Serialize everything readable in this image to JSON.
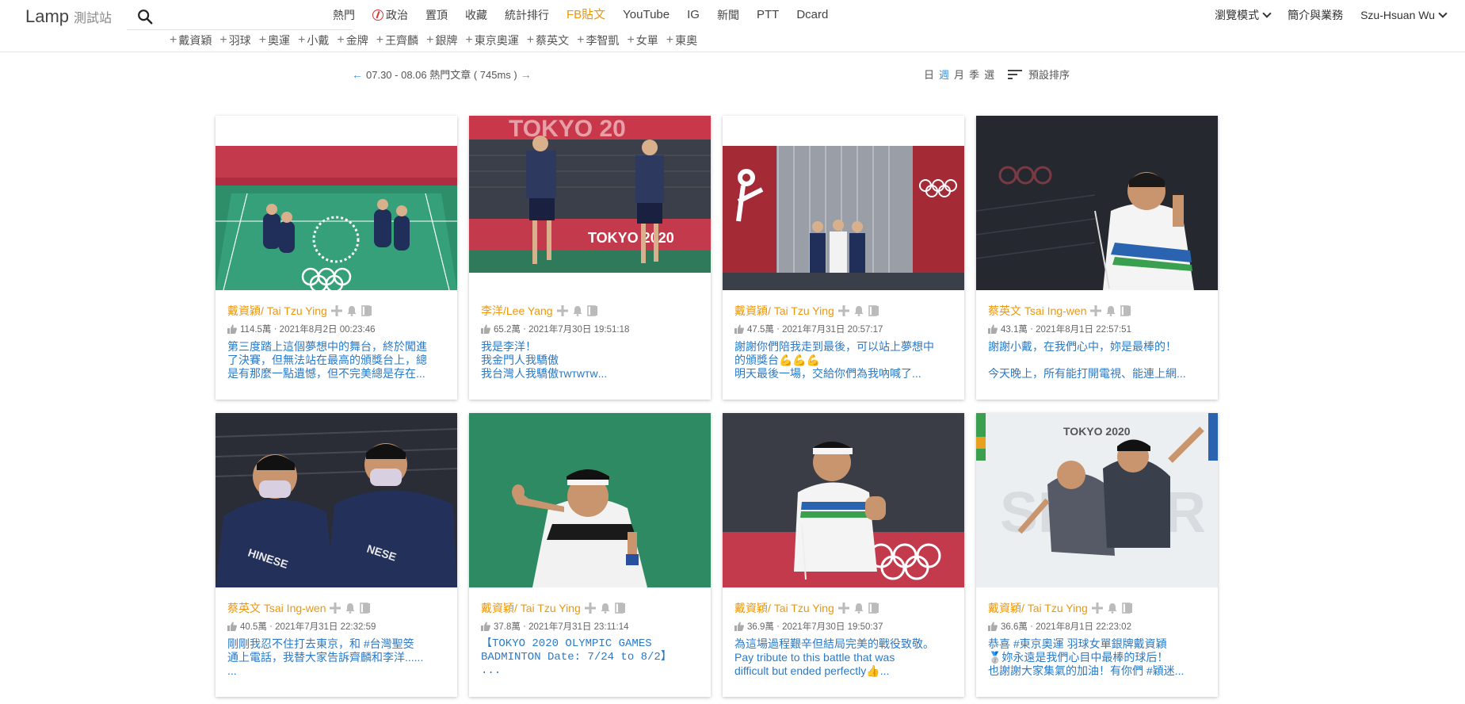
{
  "header": {
    "logo": "Lamp",
    "logo_sub": "測試站",
    "search_placeholder": "",
    "nav": [
      "熱門",
      "政治",
      "置頂",
      "收藏",
      "統計排行",
      "FB貼文",
      "YouTube",
      "IG",
      "新聞",
      "PTT",
      "Dcard"
    ],
    "right": {
      "view_mode": "瀏覽模式",
      "about": "簡介與業務",
      "user": "Szu-Hsuan Wu"
    },
    "tags": [
      "戴資穎",
      "羽球",
      "奧運",
      "小戴",
      "金牌",
      "王齊麟",
      "銀牌",
      "東京奧運",
      "蔡英文",
      "李智凱",
      "女單",
      "東奧"
    ]
  },
  "subbar": {
    "range": "07.30 - 08.06 熱門文章 ( 745ms )",
    "periods": [
      "日",
      "週",
      "月",
      "季",
      "選"
    ],
    "active_period": "週",
    "sort_label": "預設排序"
  },
  "posts": [
    {
      "author": "戴資穎/ Tai Tzu Ying",
      "likes": "114.5萬",
      "date": "2021年8月2日 00:23:46",
      "text": "第三度踏上這個夢想中的舞台，終於闖進\n了決賽，但無法站在最高的頒獎台上，總\n是有那麼一點遺憾，但不完美總是存在..."
    },
    {
      "author": "李洋/Lee Yang",
      "likes": "65.2萬",
      "date": "2021年7月30日 19:51:18",
      "text": "我是李洋！\n我金門人我驕傲\n我台灣人我驕傲ᴛᴡᴛᴡᴛᴡ..."
    },
    {
      "author": "戴資穎/ Tai Tzu Ying",
      "likes": "47.5萬",
      "date": "2021年7月31日 20:57:17",
      "text": "謝謝你們陪我走到最後，可以站上夢想中\n的頒獎台💪💪💪\n明天最後一場，交給你們為我吶喊了..."
    },
    {
      "author": "蔡英文 Tsai Ing-wen",
      "likes": "43.1萬",
      "date": "2021年8月1日 22:57:51",
      "text": "謝謝小戴，在我們心中，妳是最棒的！\n\n今天晚上，所有能打開電視、能連上網..."
    },
    {
      "author": "蔡英文 Tsai Ing-wen",
      "likes": "40.5萬",
      "date": "2021年7月31日 22:32:59",
      "text": "剛剛我忍不住打去東京，和 #台灣聖筊\n通上電話，我替大家告訴齊麟和李洋......\n      ..."
    },
    {
      "author": "戴資穎/ Tai Tzu Ying",
      "likes": "37.8萬",
      "date": "2021年7月31日 23:11:14",
      "text": "【TOKYO 2020 OLYMPIC GAMES\nBADMINTON Date: 7/24 to 8/2】\n..."
    },
    {
      "author": "戴資穎/ Tai Tzu Ying",
      "likes": "36.9萬",
      "date": "2021年7月30日 19:50:37",
      "text": "為這場過程艱辛但結局完美的戰役致敬。\nPay tribute to this battle that was\ndifficult but ended perfectly👍..."
    },
    {
      "author": "戴資穎/ Tai Tzu Ying",
      "likes": "36.6萬",
      "date": "2021年8月1日 22:23:02",
      "text": "恭喜 #東京奧運 羽球女單銀牌戴資穎\n🥈妳永遠是我們心目中最棒的球后！\n也謝謝大家集氣的加油！有你們 #穎迷..."
    }
  ]
}
